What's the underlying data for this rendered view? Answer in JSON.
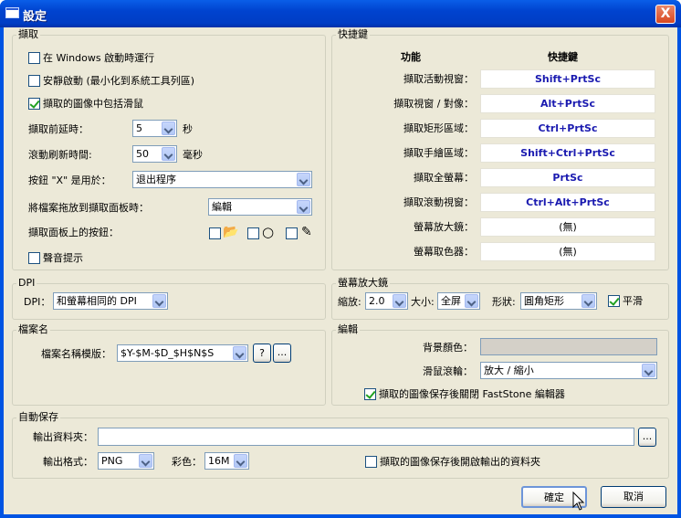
{
  "window": {
    "title": "設定",
    "close_glyph": "X"
  },
  "capture": {
    "legend": "擷取",
    "start_on_windows": {
      "label": "在 Windows 啟動時運行",
      "checked": false
    },
    "silent_start": {
      "label": "安靜啟動 (最小化到系統工具列區)",
      "checked": false
    },
    "include_cursor": {
      "label": "擷取的圖像中包括滑鼠",
      "checked": true
    },
    "delay_label": "擷取前延時：",
    "delay_value": "5",
    "delay_unit": "秒",
    "scroll_refresh_label": "滾動刷新時間:",
    "scroll_refresh_value": "50",
    "scroll_refresh_unit": "毫秒",
    "x_button_label": "按鈕 \"X\" 是用於：",
    "x_button_value": "退出程序",
    "drag_file_label": "將檔案拖放到擷取面板時：",
    "drag_file_value": "編輯",
    "panel_buttons_label": "擷取面板上的按鈕：",
    "sound_prompt": {
      "label": "聲音提示",
      "checked": false
    }
  },
  "hotkeys": {
    "legend": "快捷鍵",
    "col_function": "功能",
    "col_hotkey": "快捷鍵",
    "rows": [
      {
        "label": "擷取活動視窗：",
        "key": "Shift+PrtSc"
      },
      {
        "label": "擷取視窗 / 對像：",
        "key": "Alt+PrtSc"
      },
      {
        "label": "擷取矩形區域：",
        "key": "Ctrl+PrtSc"
      },
      {
        "label": "擷取手繪區域：",
        "key": "Shift+Ctrl+PrtSc"
      },
      {
        "label": "擷取全螢幕：",
        "key": "PrtSc"
      },
      {
        "label": "擷取滾動視窗：",
        "key": "Ctrl+Alt+PrtSc"
      },
      {
        "label": "螢幕放大鏡：",
        "key": "(無)"
      },
      {
        "label": "螢幕取色器：",
        "key": "(無)"
      }
    ]
  },
  "dpi": {
    "legend": "DPI",
    "label": "DPI：",
    "value": "和螢幕相同的 DPI"
  },
  "magnifier": {
    "legend": "螢幕放大鏡",
    "zoom_label": "縮放:",
    "zoom_value": "2.0",
    "size_label": "大小:",
    "size_value": "全屏",
    "shape_label": "形狀:",
    "shape_value": "圓角矩形",
    "smooth": {
      "label": "平滑",
      "checked": true
    }
  },
  "filename": {
    "legend": "檔案名",
    "template_label": "檔案名稱模版：",
    "template_value": "$Y-$M-$D_$H$N$S",
    "help_btn": "?",
    "browse_btn": "..."
  },
  "editor": {
    "legend": "編輯",
    "bg_color_label": "背景顏色：",
    "bg_color": "#d4d0c8",
    "wheel_label": "滑鼠滾輪：",
    "wheel_value": "放大 / 縮小",
    "close_after_save": {
      "label": "擷取的圖像保存後關閉 FastStone 編輯器",
      "checked": true
    }
  },
  "autosave": {
    "legend": "自動保存",
    "output_folder_label": "輸出資料夾：",
    "output_folder_value": "",
    "browse_btn": "...",
    "format_label": "輸出格式：",
    "format_value": "PNG",
    "color_label": "彩色：",
    "color_value": "16M",
    "open_folder": {
      "label": "擷取的圖像保存後開啟輸出的資料夾",
      "checked": false
    }
  },
  "buttons": {
    "ok": "確定",
    "cancel": "取消"
  }
}
